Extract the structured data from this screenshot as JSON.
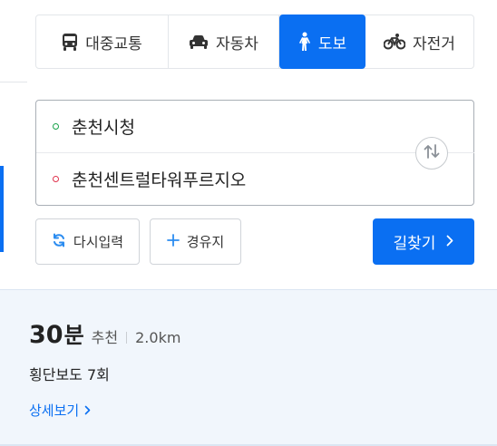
{
  "modes": [
    {
      "id": "transit",
      "label": "대중교통",
      "icon": "bus-icon",
      "active": false
    },
    {
      "id": "car",
      "label": "자동차",
      "icon": "car-icon",
      "active": false
    },
    {
      "id": "walk",
      "label": "도보",
      "icon": "walk-icon",
      "active": true
    },
    {
      "id": "bike",
      "label": "자전거",
      "icon": "bike-icon",
      "active": false
    }
  ],
  "route": {
    "origin": "춘천시청",
    "destination": "춘천센트럴타워푸르지오",
    "swap_icon": "swap-icon"
  },
  "actions": {
    "reset_label": "다시입력",
    "waypoint_label": "경유지",
    "search_label": "길찾기"
  },
  "result": {
    "duration_value": "30",
    "duration_unit": "분",
    "tag": "추천",
    "distance": "2.0km",
    "crossings": "횡단보도 7회",
    "detail_label": "상세보기"
  },
  "colors": {
    "accent": "#0a6ff2",
    "origin_dot": "#18a34a",
    "destination_dot": "#e0334d",
    "result_bg": "#f1f6fc"
  }
}
